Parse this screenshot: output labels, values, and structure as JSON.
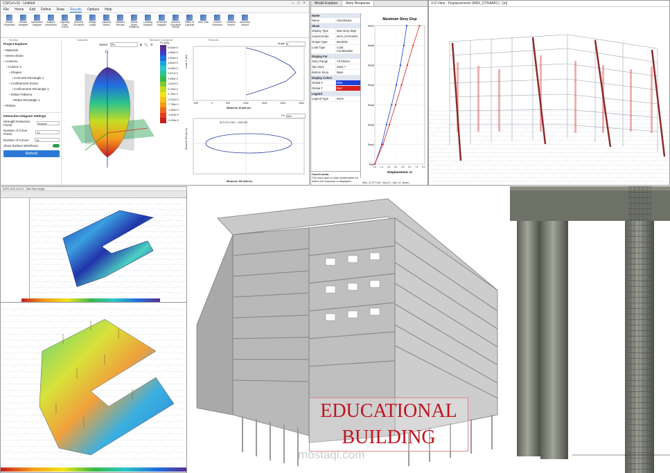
{
  "csicol": {
    "window_title": "CSICol v11 - Untitled",
    "menu": [
      "File",
      "Home",
      "Edit",
      "Define",
      "Draw",
      "Results",
      "Options",
      "Help"
    ],
    "active_menu": "Results",
    "ribbon": [
      "Section Properties",
      "Section Designer",
      "Interaction Diagram",
      "Analyze Interaction",
      "Capacity Point Check",
      "Moment Curvature",
      "Design Loads",
      "Capacity Ratios",
      "Detailed Results",
      "Stress Strain Relations",
      "Loading Diagram",
      "Envelope Diagram",
      "Moment Curvature Result",
      "Ratio Of Capacity",
      "Auto Calc",
      "Column Schedule",
      "Detailed Report",
      "Summary Report"
    ],
    "groups": [
      "Section",
      "Capacity",
      "Moment Curvature",
      "Reports"
    ],
    "explorer_title": "Project Explorer",
    "tree": [
      "Materials",
      "Stress-Strain",
      "Columns",
      "Column 1",
      "Shapes",
      "Concrete Rectangle 1",
      "Confinement Zones",
      "Confinement Rectangle 1",
      "Rebar Patterns",
      "Rebar Rectangle 1",
      "Rebars"
    ],
    "settings_title": "Interaction Diagram Settings",
    "settings": [
      {
        "label": "Strength Reduction Factor",
        "value": "Include"
      },
      {
        "label": "Number of Curve Points",
        "value": "11"
      },
      {
        "label": "Number of Curves",
        "value": "24"
      }
    ],
    "show_surface_label": "Show Surface Wireframe",
    "refresh_label": "Refresh",
    "view_select_label": "Select",
    "view_select_value": "Pu",
    "legend_title": "Pu (kN)",
    "legend_values": [
      "5.543e+3",
      "4.969e+3",
      "4.394e+3",
      "3.820e+3",
      "3.245e+3",
      "2.671e+3",
      "2.096e+3",
      "1.522e+3",
      "9.476e+2",
      "3.732e+2",
      "-2.012e+2",
      "-7.755e+2",
      "-1.350e+3",
      "-1.924e+3",
      "-2.499e+3"
    ],
    "legend_colors": [
      "#5b2d8e",
      "#3b3fc4",
      "#1f6fe0",
      "#22a5e0",
      "#2cc6c6",
      "#2dc58a",
      "#37b94a",
      "#7fcb2f",
      "#c6dc22",
      "#f2e418",
      "#f7c21a",
      "#f49b1c",
      "#ee6a1e",
      "#e23c1f",
      "#c81e1e"
    ],
    "chart1": {
      "angle_label": "Angle",
      "angle_value": "0",
      "xlabel": "Moment, M (kN-m)",
      "ylabel": "Load, P (kN)",
      "x_ticks": [
        "-500",
        "0",
        "500",
        "1000",
        "1500",
        "2000",
        "2500"
      ]
    },
    "chart2": {
      "load_label": "Pu",
      "load_value": "460",
      "caption": "90 P=P1.0 M2 = 1000 M3",
      "xlabel": "Moment, M2 (kN-m)",
      "ylabel": "Moment, M3 (kN-m)"
    }
  },
  "etabs": {
    "tabs": [
      "Model Explorer",
      "Story Response"
    ],
    "props_sections": [
      {
        "title": "Name",
        "rows": [
          [
            "Name",
            "StoryResp1"
          ]
        ]
      },
      {
        "title": "Show",
        "rows": [
          [
            "Display Type",
            "Max story displ"
          ],
          [
            "Case/Combo",
            "MAX_DYNAMIC"
          ],
          [
            "Output Type",
            "Max/Min"
          ],
          [
            "Load Type",
            "Load Combination"
          ]
        ]
      },
      {
        "title": "Display For",
        "rows": [
          [
            "Story Range",
            "All Stories"
          ],
          [
            "Top Story",
            "Story 7"
          ],
          [
            "Bottom Story",
            "Base"
          ]
        ]
      },
      {
        "title": "Display Colors",
        "rows": [
          [
            "Global X",
            "Blue"
          ],
          [
            "Global Y",
            "Red"
          ]
        ]
      },
      {
        "title": "Legend",
        "rows": [
          [
            "Legend Type",
            "None"
          ]
        ]
      }
    ],
    "case_title": "Case/Combo",
    "case_desc": "The load case or load combination for which the response is displayed.",
    "chart_title": "Maximum Story Disp",
    "chart_xlabel": "Displacement, m",
    "status": "Max: (0.077145, Story7) ; Min: (0, Base)"
  },
  "view3d": {
    "title": "3-D View - Displacements (MAX_DYNAMIC) - [m]"
  },
  "slab_app_title": "SAFE 2016 v16.0.0 - Slab Strip Design",
  "caption": {
    "line1": "EDUCATIONAL",
    "line2": "BUILDING"
  },
  "watermark": "mostaql.com",
  "chart_data": {
    "type": "line",
    "title": "Maximum Story Disp",
    "xlabel": "Displacement, m",
    "ylabel": "",
    "categories": [
      "Base",
      "Story1",
      "Story2",
      "Story3",
      "Story4",
      "Story5",
      "Story6",
      "Story7"
    ],
    "x_ticks": [
      "0.0",
      "1.2",
      "2.4",
      "3.6",
      "4.8",
      "6.0",
      "7.2",
      "8.4"
    ],
    "xlim": [
      0,
      8.6
    ],
    "series": [
      {
        "name": "Global X",
        "color": "#1f3fd6",
        "values": [
          0,
          1.2,
          2.0,
          2.9,
          3.7,
          4.4,
          5.0,
          5.5
        ]
      },
      {
        "name": "Global Y",
        "color": "#d61f1f",
        "values": [
          0,
          1.4,
          2.5,
          3.6,
          4.6,
          5.6,
          6.6,
          7.7
        ]
      }
    ]
  }
}
